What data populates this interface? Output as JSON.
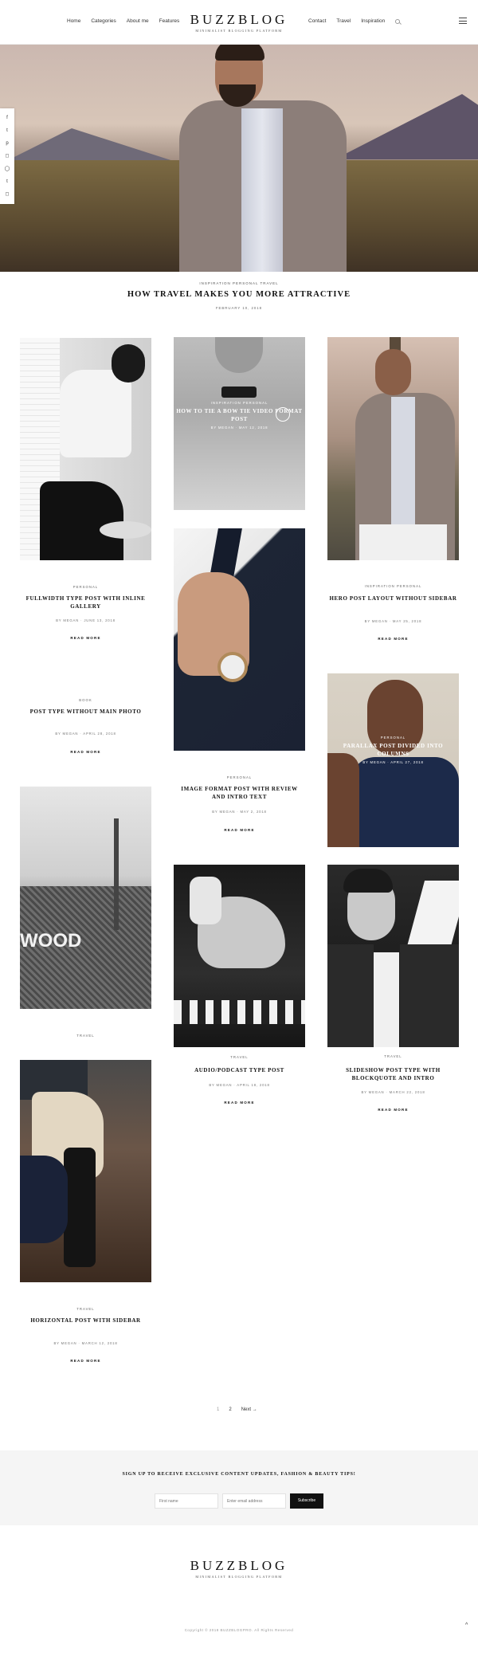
{
  "header": {
    "nav_left": [
      "Home",
      "Categories",
      "About me",
      "Features"
    ],
    "nav_right": [
      "Contact",
      "Travel",
      "Inspiration"
    ],
    "logo": "BUZZBLOG",
    "tagline": "MINIMALIST BLOGGING PLATFORM"
  },
  "social_icons": [
    "facebook-icon",
    "twitter-icon",
    "pinterest-icon",
    "instagram-icon",
    "dribbble-icon",
    "tumblr-icon",
    "instagram-alt-icon"
  ],
  "featured": {
    "categories": "INSPIRATION  PERSONAL  TRAVEL",
    "title": "HOW TRAVEL MAKES YOU MORE ATTRACTIVE",
    "date": "FEBRUARY 10, 2018"
  },
  "posts": [
    {
      "category": "PERSONAL",
      "title": "FULLWIDTH TYPE POST WITH INLINE GALLERY",
      "meta": "BY MEGAN  ·  JUNE 13, 2018",
      "read_more": "READ MORE"
    },
    {
      "category": "BOOK",
      "title": "POST TYPE WITHOUT MAIN PHOTO",
      "meta": "BY MEGAN  ·  APRIL 28, 2018",
      "read_more": "READ MORE"
    },
    {
      "category": "TRAVEL",
      "title": "",
      "meta": "",
      "read_more": ""
    },
    {
      "category": "TRAVEL",
      "title": "HORIZONTAL POST WITH SIDEBAR",
      "meta": "BY MEGAN  ·  MARCH 12, 2018",
      "read_more": "READ MORE"
    },
    {
      "category": "INSPIRATION  PERSONAL",
      "title": "HOW TO TIE A BOW TIE VIDEO FORMAT POST",
      "meta": "BY MEGAN  ·  MAY 12, 2018",
      "read_more": ""
    },
    {
      "category": "PERSONAL",
      "title": "IMAGE FORMAT POST WITH REVIEW AND INTRO TEXT",
      "meta": "BY MEGAN  ·  MAY 2, 2018",
      "read_more": "READ MORE"
    },
    {
      "category": "TRAVEL",
      "title": "AUDIO/PODCAST TYPE POST",
      "meta": "BY MEGAN  ·  APRIL 18, 2018",
      "read_more": "READ MORE"
    },
    {
      "category": "INSPIRATION  PERSONAL",
      "title": "HERO POST LAYOUT WITHOUT SIDEBAR",
      "meta": "BY MEGAN  ·  MAY 25, 2018",
      "read_more": "READ MORE"
    },
    {
      "category": "PERSONAL",
      "title": "PARALLAX POST DIVIDED INTO COLUMNS",
      "meta": "BY MEGAN  ·  APRIL 27, 2018",
      "read_more": ""
    },
    {
      "category": "TRAVEL",
      "title": "SLIDESHOW POST TYPE WITH BLOCKQUOTE AND INTRO",
      "meta": "BY MEGAN  ·  MARCH 22, 2018",
      "read_more": "READ MORE"
    }
  ],
  "hollywood_sign": "WOOD",
  "pagination": {
    "page1": "1",
    "page2": "2",
    "next": "Next →"
  },
  "newsletter": {
    "heading": "SIGN UP TO RECEIVE EXCLUSIVE CONTENT UPDATES, FASHION & BEAUTY TIPS!",
    "first_name_placeholder": "First name",
    "email_placeholder": "Enter email address",
    "subscribe_label": "Subscribe"
  },
  "footer": {
    "logo": "BUZZBLOG",
    "tagline": "MINIMALIST BLOGGING PLATFORM",
    "copyright": "Copyright © 2018 BUZZBLOGPRO. All Rights Reserved",
    "back_to_top": "^"
  }
}
